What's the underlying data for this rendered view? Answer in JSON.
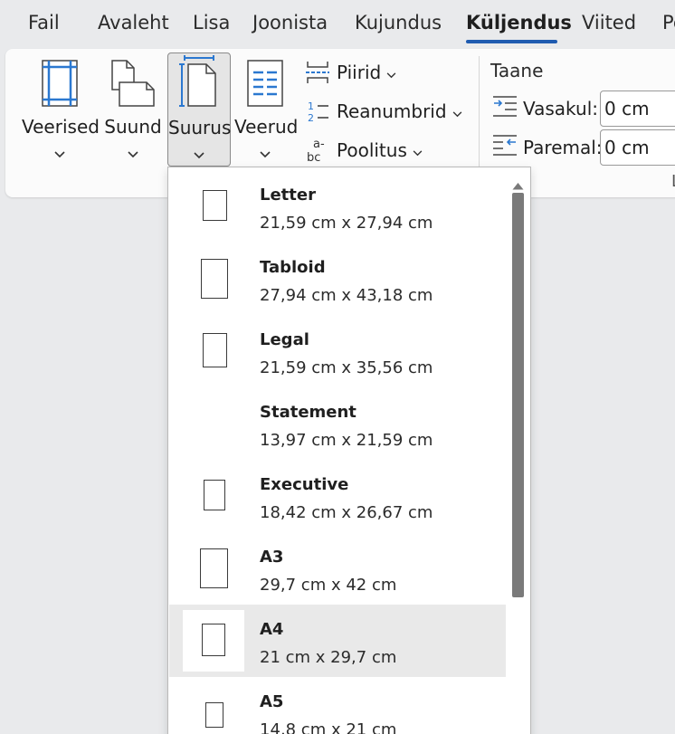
{
  "tabs": [
    {
      "label": "Fail",
      "active": false
    },
    {
      "label": "Avaleht",
      "active": false
    },
    {
      "label": "Lisa",
      "active": false
    },
    {
      "label": "Joonista",
      "active": false
    },
    {
      "label": "Kujundus",
      "active": false
    },
    {
      "label": "Küljendus",
      "active": true
    },
    {
      "label": "Viited",
      "active": false
    },
    {
      "label": "Pe",
      "active": false
    }
  ],
  "ribbon": {
    "buttons": [
      {
        "label": "Veerised",
        "icon": "margins-icon"
      },
      {
        "label": "Suund",
        "icon": "orientation-icon"
      },
      {
        "label": "Suurus",
        "icon": "size-icon",
        "selected": true
      },
      {
        "label": "Veerud",
        "icon": "columns-icon"
      }
    ],
    "small_commands": [
      {
        "label": "Piirid",
        "icon": "breaks-icon"
      },
      {
        "label": "Reanumbrid",
        "icon": "line-numbers-icon"
      },
      {
        "label": "Poolitus",
        "icon": "hyphenation-icon"
      }
    ],
    "indent": {
      "title": "Taane",
      "left_label": "Vasakul:",
      "left_value": "0 cm",
      "right_label": "Paremal:",
      "right_value": "0 cm",
      "group_label_cut": "L"
    }
  },
  "size_menu": {
    "items": [
      {
        "name": "Letter",
        "dims": "21,59 cm x 27,94 cm",
        "highlighted": false
      },
      {
        "name": "Tabloid",
        "dims": "27,94 cm x 43,18 cm",
        "highlighted": false
      },
      {
        "name": "Legal",
        "dims": "21,59 cm x 35,56 cm",
        "highlighted": false
      },
      {
        "name": "Statement",
        "dims": "13,97 cm x 21,59 cm",
        "highlighted": false
      },
      {
        "name": "Executive",
        "dims": "18,42 cm x 26,67 cm",
        "highlighted": false
      },
      {
        "name": "A3",
        "dims": "29,7 cm x 42 cm",
        "highlighted": false
      },
      {
        "name": "A4",
        "dims": "21 cm x 29,7 cm",
        "highlighted": true
      },
      {
        "name": "A5",
        "dims": "14,8 cm x 21 cm",
        "highlighted": false
      }
    ]
  },
  "colors": {
    "accent": "#1f5bb0",
    "icon_blue": "#2b78d0",
    "highlight": "#e9e9e9"
  }
}
